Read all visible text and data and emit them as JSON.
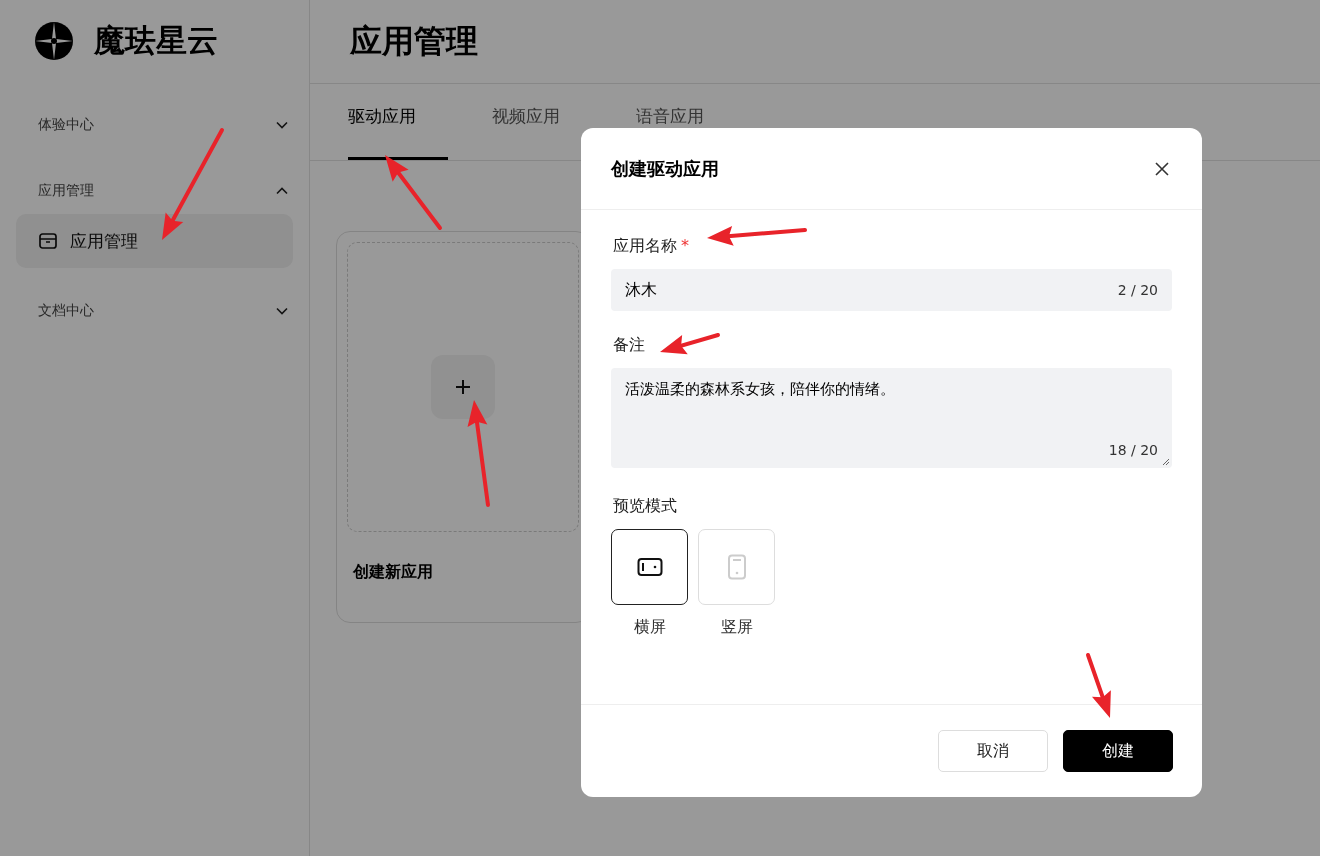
{
  "brand": {
    "name": "魔珐星云"
  },
  "sidebar": {
    "groups": [
      {
        "label": "体验中心",
        "expanded": false
      },
      {
        "label": "应用管理",
        "expanded": true,
        "items": [
          {
            "label": "应用管理",
            "selected": true
          }
        ]
      },
      {
        "label": "文档中心",
        "expanded": false
      }
    ]
  },
  "header": {
    "title": "应用管理"
  },
  "tabs": [
    {
      "label": "驱动应用",
      "selected": true
    },
    {
      "label": "视频应用",
      "selected": false
    },
    {
      "label": "语音应用",
      "selected": false
    }
  ],
  "create_card": {
    "label": "创建新应用"
  },
  "dialog": {
    "title": "创建驱动应用",
    "name_field": {
      "label": "应用名称",
      "required_mark": "*",
      "value": "沐木",
      "counter": "2 / 20"
    },
    "remark_field": {
      "label": "备注",
      "value": "活泼温柔的森林系女孩，陪伴你的情绪。",
      "counter": "18 / 20"
    },
    "preview": {
      "label": "预览模式",
      "options": [
        {
          "kind": "landscape",
          "label": "横屏",
          "selected": true
        },
        {
          "kind": "portrait",
          "label": "竖屏",
          "selected": false
        }
      ]
    },
    "buttons": {
      "cancel": "取消",
      "confirm": "创建"
    }
  }
}
